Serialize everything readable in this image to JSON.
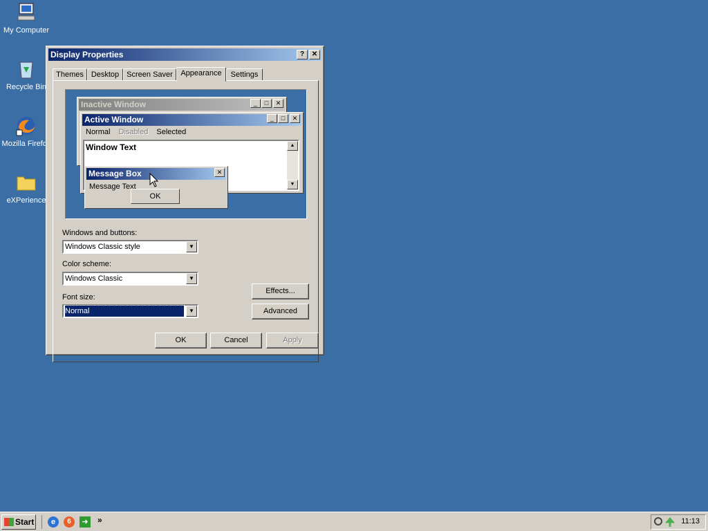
{
  "desktop": {
    "icons": [
      {
        "label": "My Computer",
        "icon": "computer-icon"
      },
      {
        "label": "Recycle Bin",
        "icon": "recycle-bin-icon"
      },
      {
        "label": "Mozilla Firefox",
        "icon": "firefox-icon"
      },
      {
        "label": "eXPerience",
        "icon": "folder-icon"
      }
    ],
    "background": "#3a6ea5"
  },
  "dialog": {
    "title": "Display Properties",
    "help_button": "?",
    "close_button": "✕",
    "tabs": [
      "Themes",
      "Desktop",
      "Screen Saver",
      "Appearance",
      "Settings"
    ],
    "active_tab": "Appearance",
    "preview": {
      "inactive_title": "Inactive Window",
      "active_title": "Active Window",
      "menu": {
        "normal": "Normal",
        "disabled": "Disabled",
        "selected": "Selected"
      },
      "window_text": "Window Text",
      "message_box_title": "Message Box",
      "message_text": "Message Text",
      "ok": "OK"
    },
    "windows_buttons_label": "Windows and buttons:",
    "windows_buttons_value": "Windows Classic style",
    "color_scheme_label": "Color scheme:",
    "color_scheme_value": "Windows Classic",
    "font_size_label": "Font size:",
    "font_size_value": "Normal",
    "effects_button": "Effects...",
    "advanced_button": "Advanced",
    "ok_button": "OK",
    "cancel_button": "Cancel",
    "apply_button": "Apply"
  },
  "taskbar": {
    "start_label": "Start",
    "quick_launch": [
      "ie-icon",
      "media-icon",
      "app-icon"
    ],
    "more": "»",
    "clock": "11:13"
  },
  "colors": {
    "active_title_start": "#0a246a",
    "active_title_end": "#a6caf0",
    "inactive_title_start": "#808080",
    "inactive_title_end": "#c0c0c0",
    "selection": "#0a246a"
  }
}
